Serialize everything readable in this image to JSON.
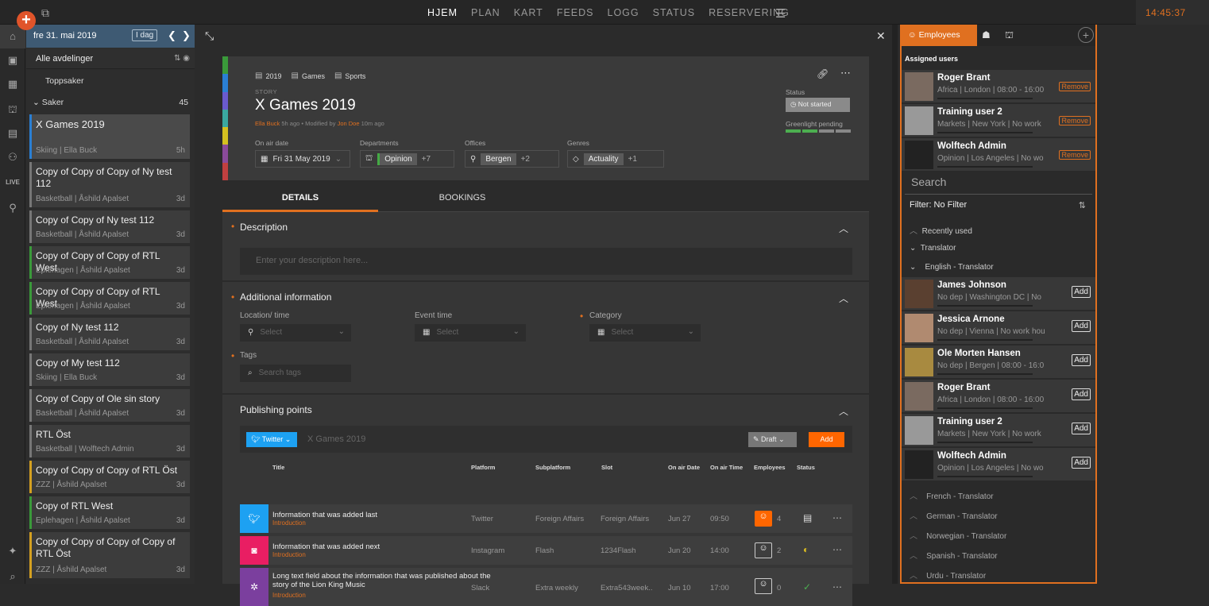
{
  "topbar": {
    "nav": [
      "HJEM",
      "PLAN",
      "KART",
      "FEEDS",
      "LOGG",
      "STATUS",
      "RESERVERING"
    ],
    "active": "HJEM",
    "clock": "14:45:37"
  },
  "list": {
    "date": "fre 31. mai 2019",
    "today_label": "I dag",
    "department": "Alle avdelinger",
    "toppsaker": "Toppsaker",
    "saker_label": "Saker",
    "saker_count": "45",
    "stories": [
      {
        "title": "X Games 2019",
        "sub": "Skiing | Ella Buck",
        "age": "5h",
        "color": "#2a7fd4"
      },
      {
        "title": "Copy of Copy of Copy of Ny test 112",
        "sub": "Basketball | Åshild Apalset",
        "age": "3d",
        "color": ""
      },
      {
        "title": "Copy of Copy of Ny test 112",
        "sub": "Basketball | Åshild Apalset",
        "age": "3d",
        "color": ""
      },
      {
        "title": "Copy of Copy of Copy of RTL West",
        "sub": "Eplehagen | Åshild Apalset",
        "age": "3d",
        "color": "#3a9a3a"
      },
      {
        "title": "Copy of Copy of Copy of RTL West",
        "sub": "Eplehagen | Åshild Apalset",
        "age": "3d",
        "color": "#3a9a3a"
      },
      {
        "title": "Copy of Ny test 112",
        "sub": "Basketball | Åshild Apalset",
        "age": "3d",
        "color": ""
      },
      {
        "title": "Copy of My test 112",
        "sub": "Skiing | Ella Buck",
        "age": "3d",
        "color": ""
      },
      {
        "title": "Copy of Copy of Ole sin story",
        "sub": "Basketball | Åshild Apalset",
        "age": "3d",
        "color": ""
      },
      {
        "title": "RTL Öst",
        "sub": "Basketball | Wolftech Admin",
        "age": "3d",
        "color": ""
      },
      {
        "title": "Copy of Copy of Copy of RTL Öst",
        "sub": "ZZZ | Åshild Apalset",
        "age": "3d",
        "color": "#d4a020"
      },
      {
        "title": "Copy of RTL West",
        "sub": "Eplehagen | Åshild Apalset",
        "age": "3d",
        "color": "#3a9a3a"
      },
      {
        "title": "Copy of Copy of Copy of Copy of RTL Öst",
        "sub": "ZZZ | Åshild Apalset",
        "age": "3d",
        "color": "#d4a020"
      }
    ]
  },
  "story": {
    "crumbs": [
      "2019",
      "Games",
      "Sports"
    ],
    "kind": "STORY",
    "title": "X Games 2019",
    "author": "Ella Buck",
    "author_age": "5h ago",
    "modified_label": "Modified by",
    "modifier": "Jon Doe",
    "modified_age": "10m ago",
    "status_label": "Status",
    "status": "Not started",
    "greenlight": "Greenlight pending",
    "on_air_label": "On air date",
    "on_air": "Fri 31 May 2019",
    "departments_label": "Departments",
    "department": "Opinion",
    "department_more": "+7",
    "offices_label": "Offices",
    "office": "Bergen",
    "office_more": "+2",
    "genres_label": "Genres",
    "genre": "Actuality",
    "genre_more": "+1"
  },
  "tabs": [
    "DETAILS",
    "BOOKINGS"
  ],
  "details": {
    "description_h": "Description",
    "description_ph": "Enter your description here...",
    "additional_h": "Additional information",
    "location_label": "Location/ time",
    "event_label": "Event time",
    "category_label": "Category",
    "select_ph": "Select",
    "tags_label": "Tags",
    "tags_ph": "Search tags",
    "publishing_h": "Publishing points",
    "twitter_btn": "Twitter",
    "pub_name": "X Games 2019",
    "draft_btn": "Draft",
    "add_btn": "Add",
    "columns": [
      "Title",
      "Platform",
      "Subplatform",
      "Slot",
      "On air Date",
      "On air Time",
      "Employees",
      "Status"
    ],
    "rows": [
      {
        "title": "Information that was added last",
        "sub": "Introduction",
        "platform": "Twitter",
        "subplatform": "Foreign Affairs",
        "slot": "Foreign Affairs",
        "date": "Jun 27",
        "time": "09:50",
        "emp": "4",
        "color": "#1da1f2",
        "icon": "twitter-icon"
      },
      {
        "title": "Information that was added next",
        "sub": "Introduction",
        "platform": "Instagram",
        "subplatform": "Flash",
        "slot": "1234Flash",
        "date": "Jun 20",
        "time": "14:00",
        "emp": "2",
        "color": "#e91e63",
        "icon": "instagram-icon"
      },
      {
        "title": "Long text field about the information that was published about the story of the Lion King Music",
        "sub": "Introduction",
        "platform": "Slack",
        "subplatform": "Extra weekly",
        "slot": "Extra543week..",
        "date": "Jun 10",
        "time": "17:00",
        "emp": "0",
        "color": "#7b3f9e",
        "icon": "slack-icon"
      }
    ]
  },
  "right": {
    "tab_employees": "Employees",
    "assigned_h": "Assigned users",
    "remove_label": "Remove",
    "add_label": "Add",
    "assigned": [
      {
        "name": "Roger Brant",
        "info": "Africa | London | 08:00 - 16:00",
        "av": "#7a6a60"
      },
      {
        "name": "Training user 2",
        "info": "Markets | New York | No work",
        "av": "#999"
      },
      {
        "name": "Wolftech Admin",
        "info": "Opinion | Los Angeles | No wo",
        "av": "#222"
      }
    ],
    "search_ph": "Search",
    "filter": "Filter: No Filter",
    "recently_used": "Recently used",
    "translator": "Translator",
    "english": "English - Translator",
    "available": [
      {
        "name": "James Johnson",
        "info": "No dep | Washington DC | No",
        "av": "#5a4030"
      },
      {
        "name": "Jessica Arnone",
        "info": "No dep | Vienna | No work hou",
        "av": "#b08a70"
      },
      {
        "name": "Ole Morten Hansen",
        "info": "No dep | Bergen | 08:00 - 16:0",
        "av": "#a88a40"
      },
      {
        "name": "Roger Brant",
        "info": "Africa | London | 08:00 - 16:00",
        "av": "#7a6a60"
      },
      {
        "name": "Training user 2",
        "info": "Markets | New York | No work",
        "av": "#999"
      },
      {
        "name": "Wolftech Admin",
        "info": "Opinion | Los Angeles | No wo",
        "av": "#222"
      }
    ],
    "groups": [
      "French - Translator",
      "German - Translator",
      "Norwegian - Translator",
      "Spanish - Translator",
      "Urdu - Translator"
    ]
  }
}
